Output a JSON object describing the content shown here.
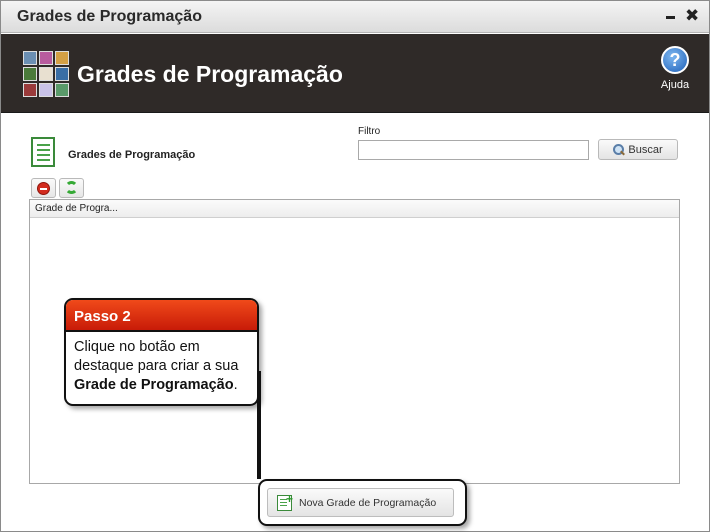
{
  "window": {
    "title": "Grades de Programação"
  },
  "header": {
    "app_title": "Grades de Programação",
    "help_label": "Ajuda",
    "help_glyph": "?",
    "app_icon_tiles": [
      "#6b8fb3",
      "#b85c9e",
      "#d4a045",
      "#4a7a3a",
      "#e8e0d0",
      "#3a6ea5",
      "#9a3a3a",
      "#c9c2e8",
      "#5a9a6a"
    ]
  },
  "content": {
    "section_title": "Grades de Programação",
    "filter_label": "Filtro",
    "filter_value": "",
    "search_label": "Buscar"
  },
  "grid": {
    "columns": [
      "Grade de Progra..."
    ]
  },
  "callout": {
    "title": "Passo 2",
    "body_prefix": "Clique no botão em destaque para criar a sua ",
    "body_bold": "Grade de Programação",
    "body_suffix": "."
  },
  "actions": {
    "new_label": "Nova Grade de Programação"
  },
  "icons": {
    "minimize": "minimize-icon",
    "close": "close-icon",
    "help": "help-icon",
    "delete": "delete-icon",
    "refresh": "refresh-icon",
    "search": "search-icon",
    "new": "new-grid-icon"
  },
  "colors": {
    "header_bg": "#2f2a28",
    "callout_head": "#e0320f",
    "help_blue": "#1d5fb8"
  }
}
